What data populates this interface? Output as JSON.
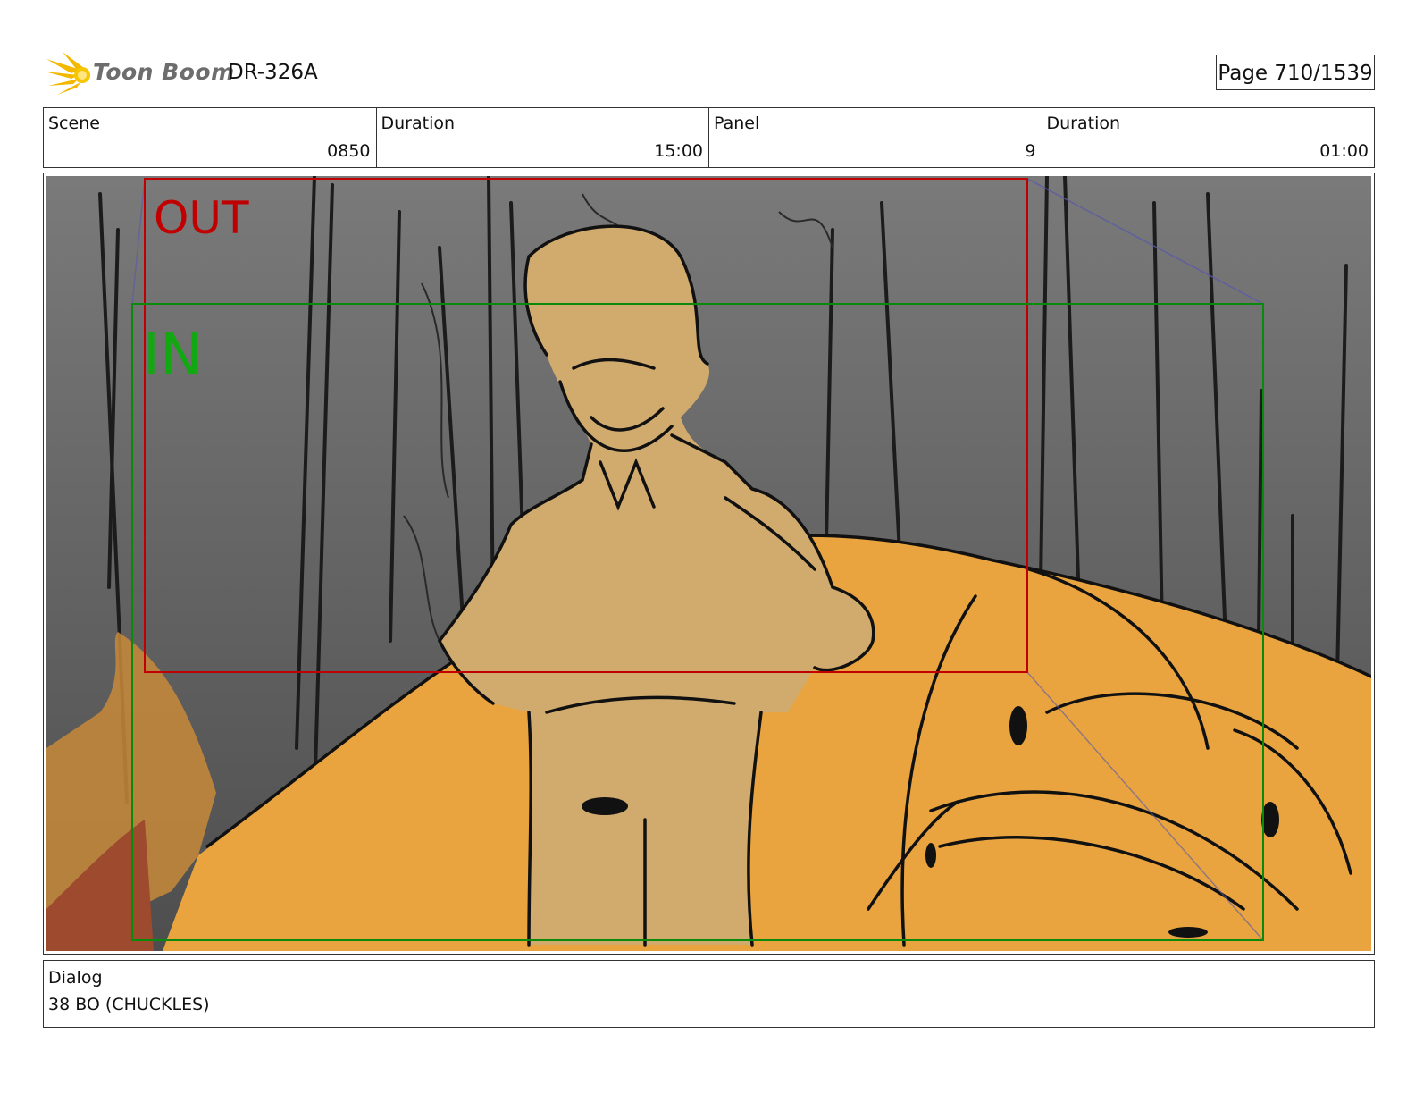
{
  "header": {
    "brand": "Toon Boom",
    "code": "DR-326A",
    "page_label": "Page",
    "page_value": "710/1539"
  },
  "info": [
    {
      "label": "Scene",
      "value": "0850"
    },
    {
      "label": "Duration",
      "value": "15:00"
    },
    {
      "label": "Panel",
      "value": "9"
    },
    {
      "label": "Duration",
      "value": "01:00"
    }
  ],
  "panel": {
    "out_label": "OUT",
    "in_label": "IN",
    "colors": {
      "out_frame": "#c00000",
      "in_frame": "#0a8a0a",
      "car": "#e9a43f",
      "character": "#d1ab6e",
      "background": "#6f6f6f"
    }
  },
  "dialog": {
    "label": "Dialog",
    "text": "38 BO (CHUCKLES)"
  }
}
